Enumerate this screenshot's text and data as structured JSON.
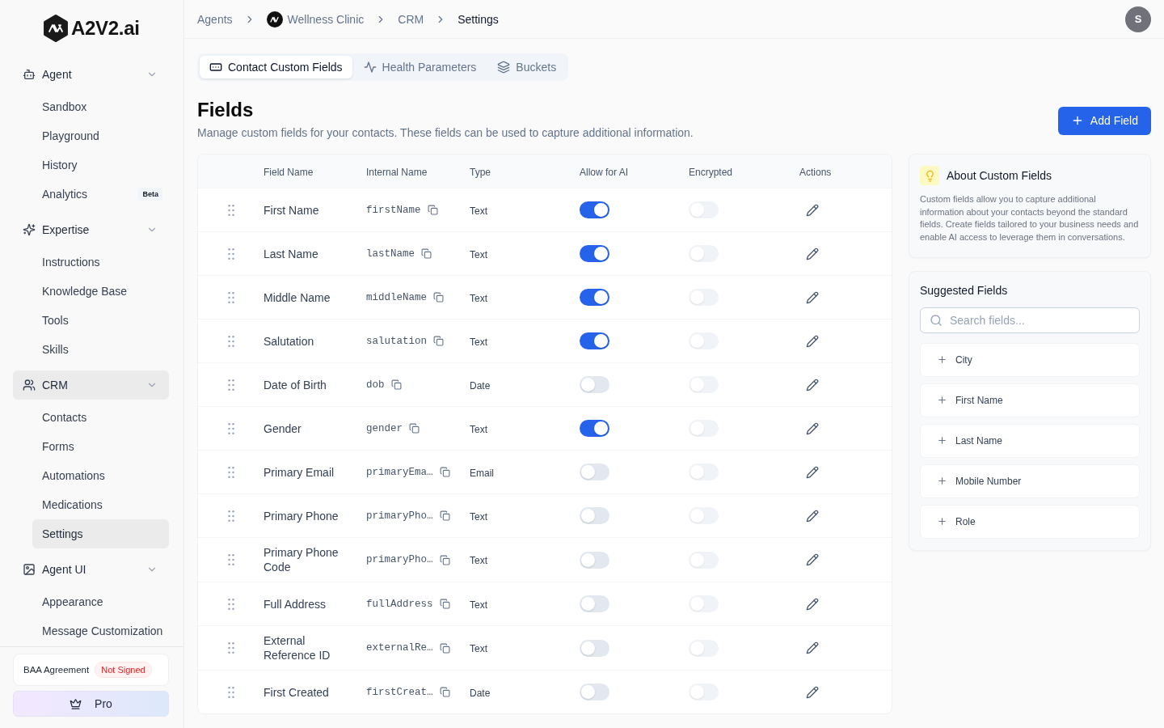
{
  "sidebar": {
    "logo": "A2V2.ai",
    "groups": [
      {
        "label": "Agent",
        "expanded": true,
        "active": false,
        "items": [
          {
            "label": "Sandbox",
            "selected": false
          },
          {
            "label": "Playground",
            "selected": false
          },
          {
            "label": "History",
            "selected": false
          },
          {
            "label": "Analytics",
            "selected": false,
            "badge": "Beta"
          }
        ]
      },
      {
        "label": "Expertise",
        "expanded": true,
        "active": false,
        "items": [
          {
            "label": "Instructions",
            "selected": false
          },
          {
            "label": "Knowledge Base",
            "selected": false
          },
          {
            "label": "Tools",
            "selected": false
          },
          {
            "label": "Skills",
            "selected": false
          }
        ]
      },
      {
        "label": "CRM",
        "expanded": true,
        "active": true,
        "items": [
          {
            "label": "Contacts",
            "selected": false
          },
          {
            "label": "Forms",
            "selected": false
          },
          {
            "label": "Automations",
            "selected": false
          },
          {
            "label": "Medications",
            "selected": false
          },
          {
            "label": "Settings",
            "selected": true
          }
        ]
      },
      {
        "label": "Agent UI",
        "expanded": true,
        "active": false,
        "items": [
          {
            "label": "Appearance",
            "selected": false
          },
          {
            "label": "Message Customization",
            "selected": false
          }
        ]
      }
    ],
    "baa": {
      "label": "BAA Agreement",
      "status": "Not Signed"
    },
    "pro_button": "Pro"
  },
  "header": {
    "breadcrumb": [
      {
        "kind": "link",
        "label": "Agents",
        "current": false
      },
      {
        "kind": "agent",
        "label": "Wellness Clinic",
        "current": false
      },
      {
        "kind": "link",
        "label": "CRM",
        "current": false
      },
      {
        "kind": "link",
        "label": "Settings",
        "current": true
      }
    ],
    "user_initial": "S"
  },
  "tabs": [
    {
      "label": "Contact Custom Fields",
      "selected": true
    },
    {
      "label": "Health Parameters",
      "selected": false
    },
    {
      "label": "Buckets",
      "selected": false
    }
  ],
  "page": {
    "title": "Fields",
    "description": "Manage custom fields for your contacts. These fields can be used to capture additional information.",
    "add_button": "Add Field"
  },
  "table": {
    "columns": [
      "Field Name",
      "Internal Name",
      "Type",
      "Allow for AI",
      "Encrypted",
      "Actions"
    ],
    "rows": [
      {
        "field_name": "First Name",
        "internal_name": "firstName",
        "type": "Text",
        "allow_ai": true,
        "encrypted": false
      },
      {
        "field_name": "Last Name",
        "internal_name": "lastName",
        "type": "Text",
        "allow_ai": true,
        "encrypted": false
      },
      {
        "field_name": "Middle Name",
        "internal_name": "middleName",
        "type": "Text",
        "allow_ai": true,
        "encrypted": false
      },
      {
        "field_name": "Salutation",
        "internal_name": "salutation",
        "type": "Text",
        "allow_ai": true,
        "encrypted": false
      },
      {
        "field_name": "Date of Birth",
        "internal_name": "dob",
        "type": "Date",
        "allow_ai": false,
        "encrypted": false
      },
      {
        "field_name": "Gender",
        "internal_name": "gender",
        "type": "Text",
        "allow_ai": true,
        "encrypted": false
      },
      {
        "field_name": "Primary Email",
        "internal_name": "primaryEma…",
        "type": "Email",
        "allow_ai": false,
        "encrypted": false
      },
      {
        "field_name": "Primary Phone",
        "internal_name": "primaryPho…",
        "type": "Text",
        "allow_ai": false,
        "encrypted": false
      },
      {
        "field_name": "Primary Phone Code",
        "internal_name": "primaryPho…",
        "type": "Text",
        "allow_ai": false,
        "encrypted": false
      },
      {
        "field_name": "Full Address",
        "internal_name": "fullAddress",
        "type": "Text",
        "allow_ai": false,
        "encrypted": false
      },
      {
        "field_name": "External Reference ID",
        "internal_name": "externalRe…",
        "type": "Text",
        "allow_ai": false,
        "encrypted": false
      },
      {
        "field_name": "First Created",
        "internal_name": "firstCreat…",
        "type": "Date",
        "allow_ai": false,
        "encrypted": false
      }
    ]
  },
  "about": {
    "title": "About Custom Fields",
    "body": "Custom fields allow you to capture additional information about your contacts beyond the standard fields. Create fields tailored to your business needs and enable AI access to leverage them in conversations."
  },
  "suggested": {
    "title": "Suggested Fields",
    "search": {
      "placeholder": "Search fields..."
    },
    "items": [
      {
        "label": "City"
      },
      {
        "label": "First Name"
      },
      {
        "label": "Last Name"
      },
      {
        "label": "Mobile Number"
      },
      {
        "label": "Role"
      }
    ]
  }
}
